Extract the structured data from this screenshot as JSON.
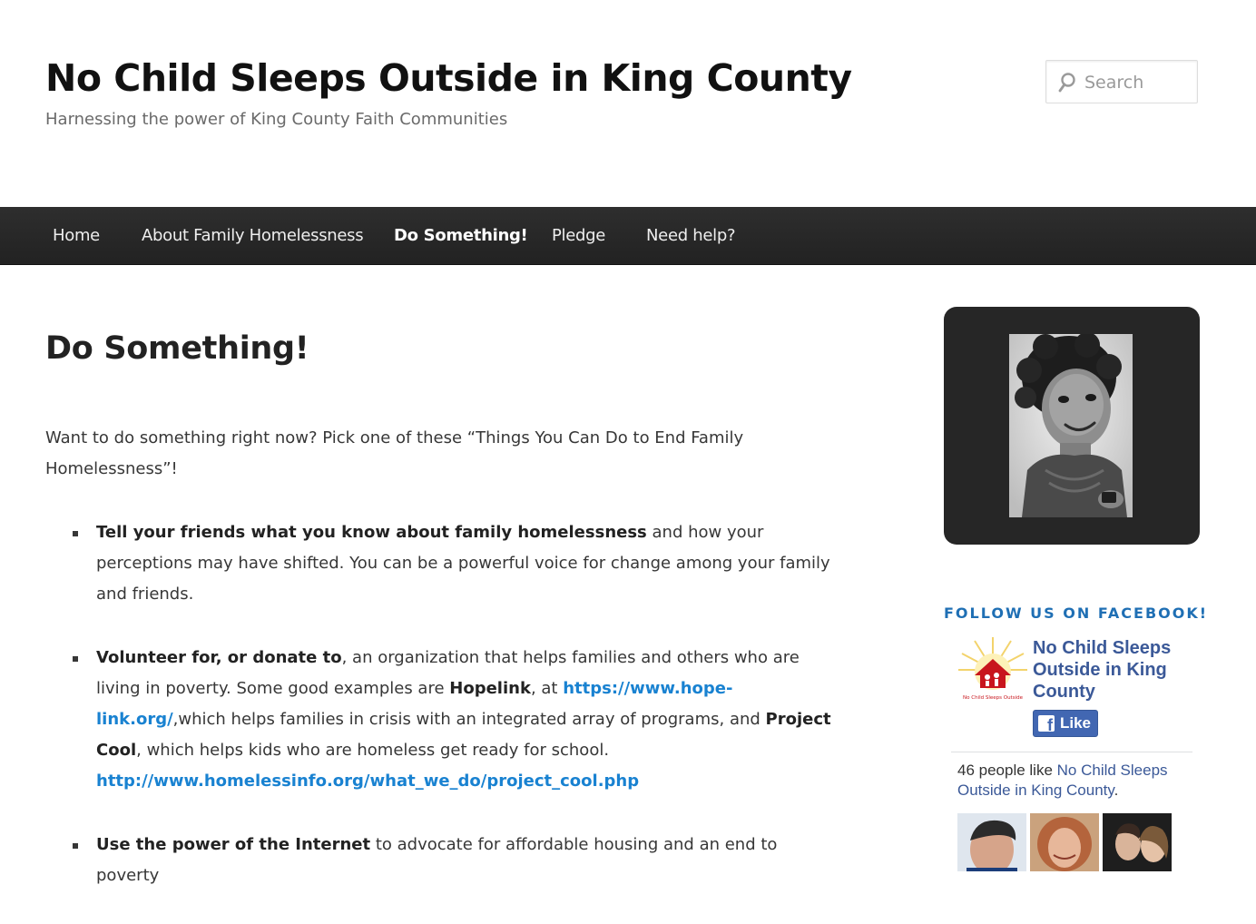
{
  "site": {
    "title": "No Child Sleeps Outside in King County",
    "description": "Harnessing the power of King County Faith Communities"
  },
  "search": {
    "placeholder": "Search",
    "icon": "search-icon"
  },
  "nav": {
    "items": [
      {
        "label": "Home"
      },
      {
        "label": "About Family Homelessness"
      },
      {
        "label": "Do Something!",
        "current": true
      },
      {
        "label": "Pledge"
      },
      {
        "label": "Need help?"
      }
    ]
  },
  "page": {
    "title": "Do Something!",
    "intro": "Want to do something right now? Pick one of these “Things You Can Do to End Family Homelessness”!",
    "items": [
      {
        "bold": "Tell your friends what you know about family homelessness",
        "text": " and how your perceptions may have shifted. You can be a powerful voice for change among your family and friends."
      },
      {
        "bold": "Volunteer for, or donate to",
        "text1": ", an organization that helps families and others who are living in poverty. Some good examples are ",
        "org1": "Hopelink",
        "text2": ", at ",
        "link1": "https://www.hope-link.org/",
        "text3": ",which helps families in crisis with an integrated array of programs, and ",
        "org2": "Project Cool",
        "text4": ", which helps kids who are homeless get ready for school. ",
        "link2": "http://www.homelessinfo.org/what_we_do/project_cool.php"
      },
      {
        "bold": "Use the power of the Internet",
        "text": " to advocate for affordable housing and an end to poverty"
      }
    ]
  },
  "sidebar": {
    "photo_alt": "black and white photo of a smiling young child",
    "widget_title": "FOLLOW US ON FACEBOOK!",
    "facebook": {
      "page_name": "No Child Sleeps Outside in King County",
      "logo_caption": "No Child Sleeps Outside",
      "like_label": "Like",
      "count_prefix": "46 people like ",
      "count_link": "No Child Sleeps Outside in King County",
      "count_suffix": "."
    }
  },
  "colors": {
    "nav_bg": "#252525",
    "link": "#1982d1",
    "widget_title": "#1f6fb4",
    "facebook_blue": "#3b5998"
  }
}
